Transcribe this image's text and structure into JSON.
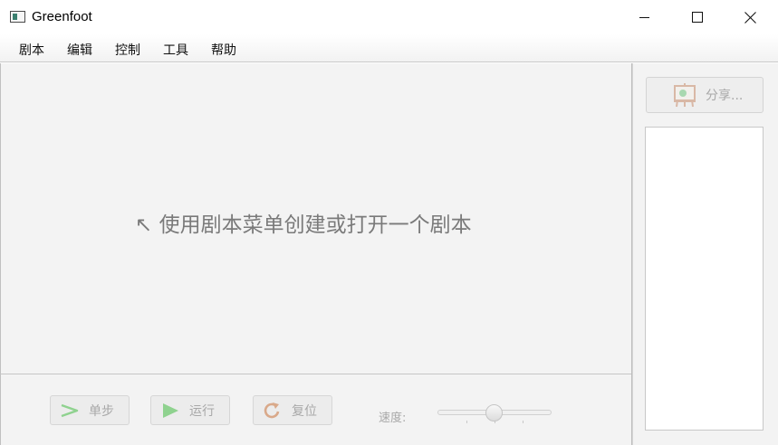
{
  "window": {
    "title": "Greenfoot",
    "app_icon": "greenfoot-app-icon",
    "controls": {
      "minimize_icon": "minimize-icon",
      "maximize_icon": "maximize-icon",
      "close_icon": "close-icon"
    }
  },
  "menu": {
    "items": [
      {
        "label": "剧本"
      },
      {
        "label": "编辑"
      },
      {
        "label": "控制"
      },
      {
        "label": "工具"
      },
      {
        "label": "帮助"
      }
    ]
  },
  "main": {
    "hint_text": "↖ 使用剧本菜单创建或打开一个剧本"
  },
  "controls": {
    "step": {
      "label": "单步",
      "icon": "step-arrow-icon",
      "enabled": false
    },
    "run": {
      "label": "运行",
      "icon": "play-icon",
      "enabled": false
    },
    "reset": {
      "label": "复位",
      "icon": "reset-icon",
      "enabled": false
    },
    "speed_label": "速度:",
    "speed_value": 0.5
  },
  "side": {
    "share": {
      "label": "分享...",
      "icon": "easel-share-icon",
      "enabled": false
    }
  },
  "colors": {
    "disabled_text": "#a8a8a8",
    "hint_text": "#7a7a7a",
    "accent_green": "#5bbf5b",
    "reset_orange": "#c9895a"
  }
}
